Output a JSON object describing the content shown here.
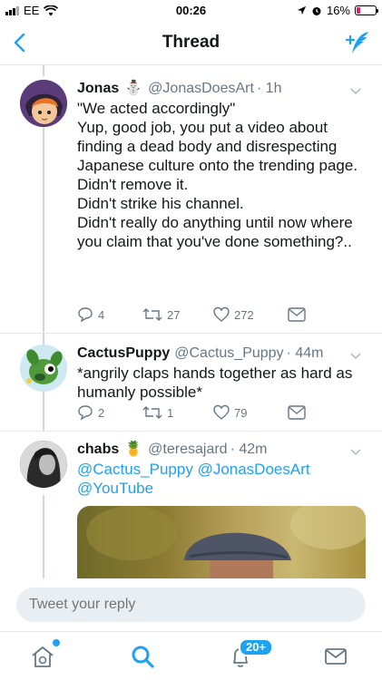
{
  "status": {
    "carrier": "EE",
    "time": "00:26",
    "battery": "16%"
  },
  "nav": {
    "title": "Thread"
  },
  "tweets": [
    {
      "name": "Jonas",
      "emoji": "⛄",
      "handle": "@JonasDoesArt",
      "time": "· 1h",
      "lines": [
        "\"We acted accordingly\"",
        "Yup, good job, you put a video about finding a dead body and disrespecting Japanese culture onto the trending page.",
        "Didn't remove it.",
        "Didn't strike his channel.",
        "Didn't really do anything until now where you claim that you've done something?.."
      ],
      "replies": "4",
      "retweets": "27",
      "likes": "272"
    },
    {
      "name": "CactusPuppy",
      "emoji": "",
      "handle": "@Cactus_Puppy",
      "time": "· 44m",
      "text": "*angrily claps hands together as hard as humanly possible*",
      "replies": "2",
      "retweets": "1",
      "likes": "79"
    },
    {
      "name": "chabs",
      "emoji": "🍍",
      "handle": "@teresajard",
      "time": "· 42m",
      "mention1": "@Cactus_Puppy",
      "mention2": "@JonasDoesArt",
      "mention3": "@YouTube"
    }
  ],
  "reply": {
    "placeholder": "Tweet your reply"
  },
  "tabs": {
    "notifications_badge": "20+"
  },
  "colors": {
    "accent": "#1da1f2",
    "text": "#14171a",
    "secondary": "#657786",
    "battery_low": "#e0245e"
  }
}
